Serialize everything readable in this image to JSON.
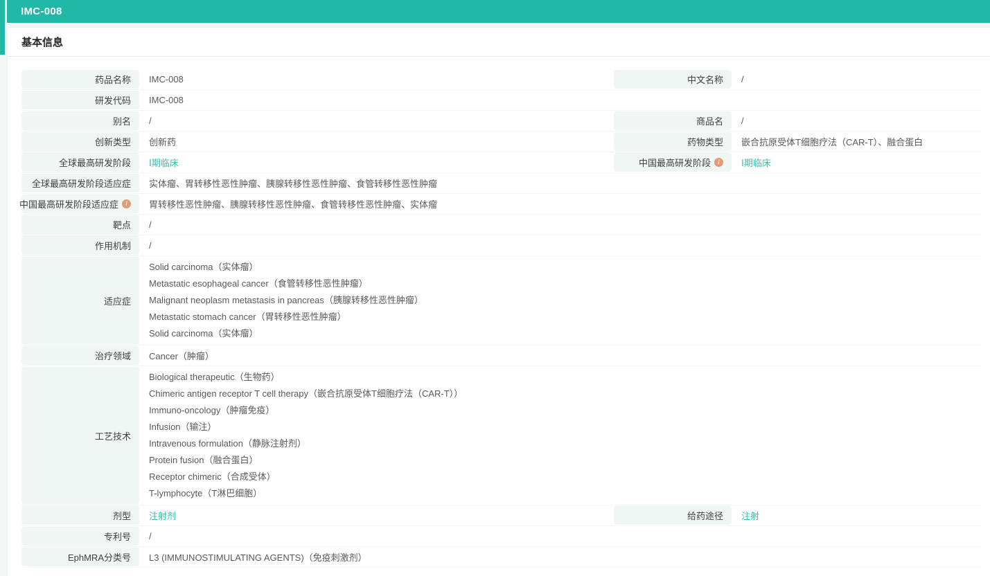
{
  "header": {
    "title": "IMC-008"
  },
  "section": {
    "title": "基本信息"
  },
  "colors": {
    "accent": "#22b8a8",
    "link": "#3dbcab",
    "label_bg": "#eff6f4",
    "info_icon": "#e49a75"
  },
  "icons": {
    "info": "i"
  },
  "table": {
    "rows": [
      {
        "type": "pair",
        "left": {
          "label": "药品名称",
          "value": "IMC-008"
        },
        "right": {
          "label": "中文名称",
          "value": "/"
        }
      },
      {
        "type": "left",
        "left": {
          "label": "研发代码",
          "value": "IMC-008"
        }
      },
      {
        "type": "pair",
        "left": {
          "label": "别名",
          "value": "/"
        },
        "right": {
          "label": "商品名",
          "value": "/"
        }
      },
      {
        "type": "pair",
        "left": {
          "label": "创新类型",
          "value": "创新药"
        },
        "right": {
          "label": "药物类型",
          "value": "嵌合抗原受体T细胞疗法（CAR-T）、融合蛋白"
        }
      },
      {
        "type": "pair",
        "left": {
          "label": "全球最高研发阶段",
          "value": "Ⅰ期临床",
          "link": true
        },
        "right": {
          "label": "中国最高研发阶段",
          "info": true,
          "value": "Ⅰ期临床",
          "link": true
        }
      },
      {
        "type": "full",
        "left": {
          "label": "全球最高研发阶段适应症",
          "value": "实体瘤、胃转移性恶性肿瘤、胰腺转移性恶性肿瘤、食管转移性恶性肿瘤"
        }
      },
      {
        "type": "full",
        "left": {
          "label": "中国最高研发阶段适应症",
          "info": true,
          "value": "胃转移性恶性肿瘤、胰腺转移性恶性肿瘤、食管转移性恶性肿瘤、实体瘤"
        }
      },
      {
        "type": "full",
        "left": {
          "label": "靶点",
          "value": "/"
        }
      },
      {
        "type": "full",
        "left": {
          "label": "作用机制",
          "value": "/"
        }
      },
      {
        "type": "full",
        "left": {
          "label": "适应症",
          "lines": [
            "Solid carcinoma（实体瘤）",
            "Metastatic esophageal cancer（食管转移性恶性肿瘤）",
            "Malignant neoplasm metastasis in pancreas（胰腺转移性恶性肿瘤）",
            "Metastatic stomach cancer（胃转移性恶性肿瘤）",
            "Solid carcinoma（实体瘤）"
          ]
        }
      },
      {
        "type": "full",
        "left": {
          "label": "治疗领域",
          "value": "Cancer（肿瘤）"
        }
      },
      {
        "type": "full",
        "left": {
          "label": "工艺技术",
          "lines": [
            "Biological therapeutic（生物药）",
            "Chimeric antigen receptor T cell therapy（嵌合抗原受体T细胞疗法（CAR-T））",
            "Immuno-oncology（肿瘤免疫）",
            "Infusion（输注）",
            "Intravenous formulation（静脉注射剂）",
            "Protein fusion（融合蛋白）",
            "Receptor chimeric（合成受体）",
            "T-lymphocyte（T淋巴细胞）"
          ]
        }
      },
      {
        "type": "pair",
        "left": {
          "label": "剂型",
          "value": "注射剂",
          "link": true
        },
        "right": {
          "label": "给药途径",
          "value": "注射",
          "link": true
        }
      },
      {
        "type": "full",
        "left": {
          "label": "专利号",
          "value": "/"
        }
      },
      {
        "type": "full",
        "left": {
          "label": "EphMRA分类号",
          "value": "L3 (IMMUNOSTIMULATING AGENTS)（免疫刺激剂）"
        }
      }
    ]
  }
}
